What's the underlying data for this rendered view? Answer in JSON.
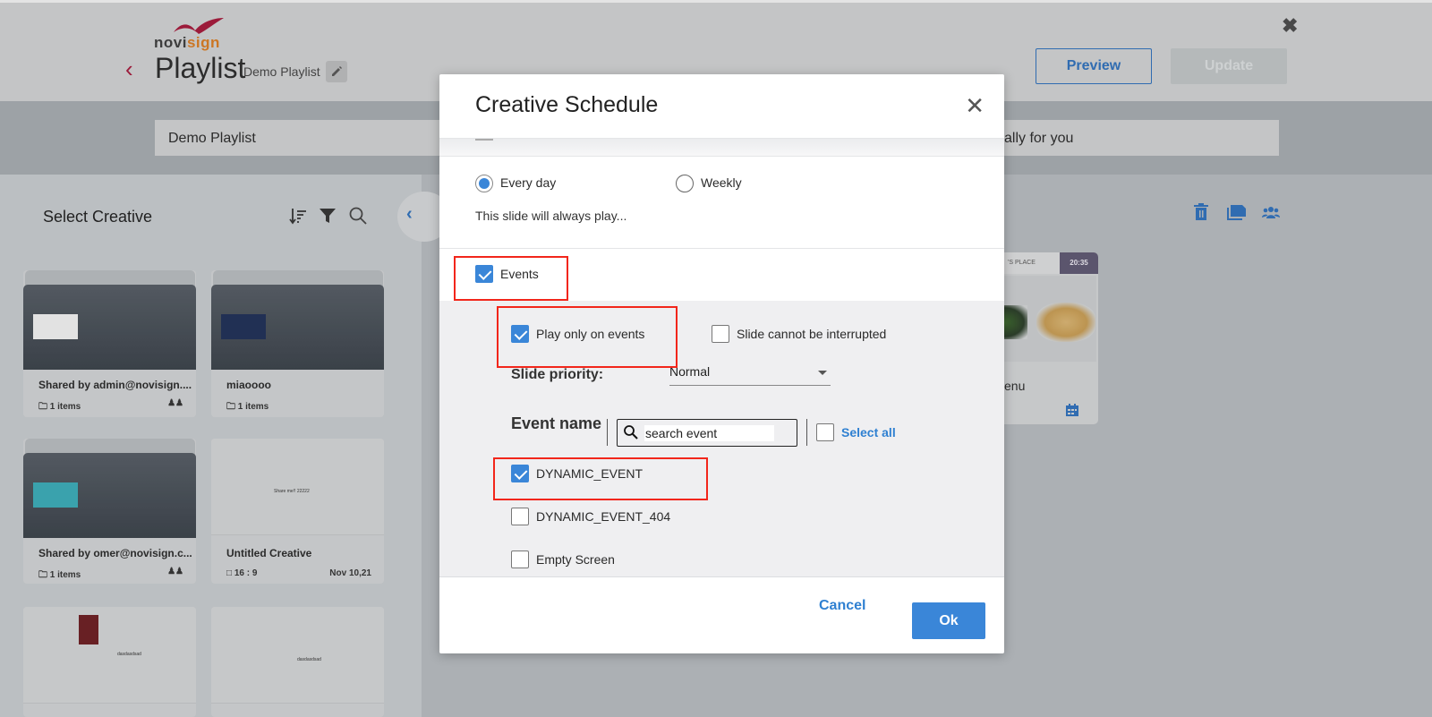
{
  "header": {
    "logo_left": "novi",
    "logo_right": "sign",
    "title": "Playlist",
    "subtitle": "Demo Playlist",
    "preview_label": "Preview",
    "update_label": "Update"
  },
  "playlist_name": {
    "value": "Demo Playlist",
    "right_text_fragment": "ally for you"
  },
  "left_panel": {
    "title": "Select Creative",
    "cards": [
      {
        "title": "Shared by admin@novisign....",
        "meta": "1 items",
        "type": "folder",
        "shared": true
      },
      {
        "title": "miaoooo",
        "meta": "1 items",
        "type": "folder",
        "shared": false
      },
      {
        "title": "Shared by omer@novisign.c...",
        "meta": "1 items",
        "type": "folder",
        "shared": true
      },
      {
        "title": "Untitled Creative",
        "meta": "16 : 9",
        "date": "Nov 10,21",
        "preview_text": "Share me!! 22222",
        "type": "creative"
      },
      {
        "title": "",
        "preview_text": "dasdasdsad",
        "type": "creative"
      },
      {
        "title": "",
        "preview_text": "dasdasdsad",
        "type": "creative"
      }
    ]
  },
  "right_area": {
    "menu_card": {
      "header": "'S PLACE",
      "time": "20:35",
      "name": "enu"
    }
  },
  "modal": {
    "title": "Creative Schedule",
    "schedule": {
      "options": [
        {
          "label": "Every day",
          "selected": true
        },
        {
          "label": "Weekly",
          "selected": false
        }
      ],
      "hint": "This slide will always play..."
    },
    "events": {
      "label": "Events",
      "checked": true,
      "play_only_on_events": {
        "label": "Play only on events",
        "checked": true
      },
      "cannot_interrupt": {
        "label": "Slide cannot be interrupted",
        "checked": false
      },
      "priority_label": "Slide priority:",
      "priority_value": "Normal",
      "event_name_label": "Event name",
      "search_placeholder": "search event",
      "select_all_label": "Select all",
      "select_all_checked": false,
      "items": [
        {
          "label": "DYNAMIC_EVENT",
          "checked": true
        },
        {
          "label": "DYNAMIC_EVENT_404",
          "checked": false
        },
        {
          "label": "Empty Screen",
          "checked": false
        }
      ]
    },
    "cancel_label": "Cancel",
    "ok_label": "Ok"
  },
  "colors": {
    "accent": "#3a86d8",
    "brand_red": "#a2193a",
    "highlight_box": "#f2261b"
  }
}
